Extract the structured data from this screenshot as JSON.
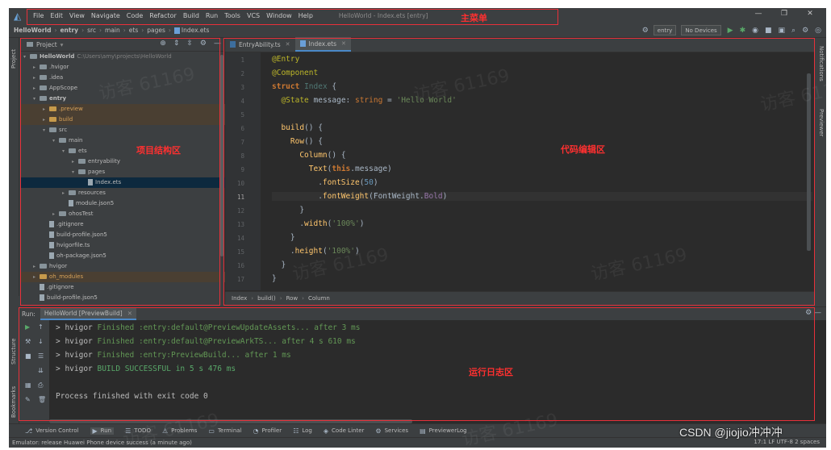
{
  "menubar": {
    "items": [
      "File",
      "Edit",
      "View",
      "Navigate",
      "Code",
      "Refactor",
      "Build",
      "Run",
      "Tools",
      "VCS",
      "Window",
      "Help"
    ],
    "window_title": "HelloWorld - Index.ets [entry]",
    "minimize": "—",
    "restore": "❐",
    "close": "✕"
  },
  "navbar": {
    "crumbs": [
      "HelloWorld",
      "entry",
      "src",
      "main",
      "ets",
      "pages",
      "Index.ets"
    ],
    "run_config": "entry",
    "device": "No Devices"
  },
  "project": {
    "title": "Project",
    "tree": [
      {
        "depth": 0,
        "arrow": "▾",
        "icon": "folder",
        "label": "HelloWorld",
        "hint": "C:\\Users\\amy\\projects\\HelloWorld",
        "bold": true
      },
      {
        "depth": 1,
        "arrow": "▸",
        "icon": "folder",
        "label": ".hvigor"
      },
      {
        "depth": 1,
        "arrow": "▸",
        "icon": "folder",
        "label": ".idea"
      },
      {
        "depth": 1,
        "arrow": "▸",
        "icon": "folder",
        "label": "AppScope"
      },
      {
        "depth": 1,
        "arrow": "▾",
        "icon": "folder",
        "label": "entry",
        "bold": true
      },
      {
        "depth": 2,
        "arrow": "▸",
        "icon": "folder-o",
        "label": ".preview",
        "excluded": true
      },
      {
        "depth": 2,
        "arrow": "▸",
        "icon": "folder-o",
        "label": "build",
        "excluded": true
      },
      {
        "depth": 2,
        "arrow": "▾",
        "icon": "folder",
        "label": "src"
      },
      {
        "depth": 3,
        "arrow": "▾",
        "icon": "folder",
        "label": "main"
      },
      {
        "depth": 4,
        "arrow": "▾",
        "icon": "folder",
        "label": "ets"
      },
      {
        "depth": 5,
        "arrow": "▸",
        "icon": "folder",
        "label": "entryability"
      },
      {
        "depth": 5,
        "arrow": "▾",
        "icon": "folder",
        "label": "pages"
      },
      {
        "depth": 6,
        "arrow": "",
        "icon": "file",
        "label": "Index.ets",
        "selected": true
      },
      {
        "depth": 4,
        "arrow": "▸",
        "icon": "folder",
        "label": "resources"
      },
      {
        "depth": 4,
        "arrow": "",
        "icon": "file",
        "label": "module.json5"
      },
      {
        "depth": 3,
        "arrow": "▸",
        "icon": "folder",
        "label": "ohosTest"
      },
      {
        "depth": 2,
        "arrow": "",
        "icon": "file",
        "label": ".gitignore"
      },
      {
        "depth": 2,
        "arrow": "",
        "icon": "file",
        "label": "build-profile.json5"
      },
      {
        "depth": 2,
        "arrow": "",
        "icon": "file",
        "label": "hvigorfile.ts"
      },
      {
        "depth": 2,
        "arrow": "",
        "icon": "file",
        "label": "oh-package.json5"
      },
      {
        "depth": 1,
        "arrow": "▸",
        "icon": "folder",
        "label": "hvigor"
      },
      {
        "depth": 1,
        "arrow": "▸",
        "icon": "folder-o",
        "label": "oh_modules",
        "excluded": true
      },
      {
        "depth": 1,
        "arrow": "",
        "icon": "file",
        "label": ".gitignore"
      },
      {
        "depth": 1,
        "arrow": "",
        "icon": "file",
        "label": "build-profile.json5"
      }
    ]
  },
  "editor": {
    "tabs": [
      {
        "label": "EntryAbility.ts"
      },
      {
        "label": "Index.ets",
        "active": true
      }
    ],
    "line_numbers": [
      "1",
      "2",
      "3",
      "4",
      "5",
      "6",
      "7",
      "8",
      "9",
      "10",
      "11",
      "12",
      "13",
      "14",
      "15",
      "16",
      "17"
    ],
    "breadcrumbs": [
      "Index",
      "build()",
      "Row",
      "Column"
    ]
  },
  "side_labels": {
    "project": "Project",
    "structure": "Structure",
    "bookmarks": "Bookmarks",
    "notifications": "Notifications",
    "previewer": "Previewer"
  },
  "run": {
    "label": "Run:",
    "tab": "HelloWorld [PreviewBuild]",
    "lines": [
      {
        "prefix": "> hvigor ",
        "text": "Finished :entry:default@PreviewUpdateAssets... after 3 ms",
        "cls": "g"
      },
      {
        "prefix": "> hvigor ",
        "text": "Finished :entry:default@PreviewArkTS... after 4 s 610 ms",
        "cls": "g"
      },
      {
        "prefix": "> hvigor ",
        "text": "Finished :entry:PreviewBuild... after 1 ms",
        "cls": "g"
      },
      {
        "prefix": "> hvigor ",
        "text": "BUILD SUCCESSFUL in 5 s 476 ms",
        "cls": "gs"
      },
      {
        "prefix": "",
        "text": "",
        "cls": ""
      },
      {
        "prefix": "Process finished with exit code 0",
        "text": "",
        "cls": ""
      }
    ]
  },
  "bottom_tools": [
    "Version Control",
    "Run",
    "TODO",
    "Problems",
    "Terminal",
    "Profiler",
    "Log",
    "Code Linter",
    "Services",
    "PreviewerLog"
  ],
  "status": {
    "left": "Emulator: release Huawei Phone device success (a minute ago)",
    "right": "17:1   LF   UTF-8   2 spaces"
  },
  "annotations": {
    "main_menu": "主菜单",
    "project_area": "项目结构区",
    "code_area": "代码编辑区",
    "log_area": "运行日志区"
  },
  "watermarks": [
    "访客 61169",
    "访客 61169",
    "访客 61169",
    "访客 61169",
    "访客 61169",
    "访客 61169",
    "访客 61169"
  ],
  "credit": "CSDN @jiojio冲冲冲",
  "colors": {
    "annotation": "#e8303a",
    "keyword": "#cc7832",
    "string": "#6a8759",
    "success": "#59a869"
  }
}
